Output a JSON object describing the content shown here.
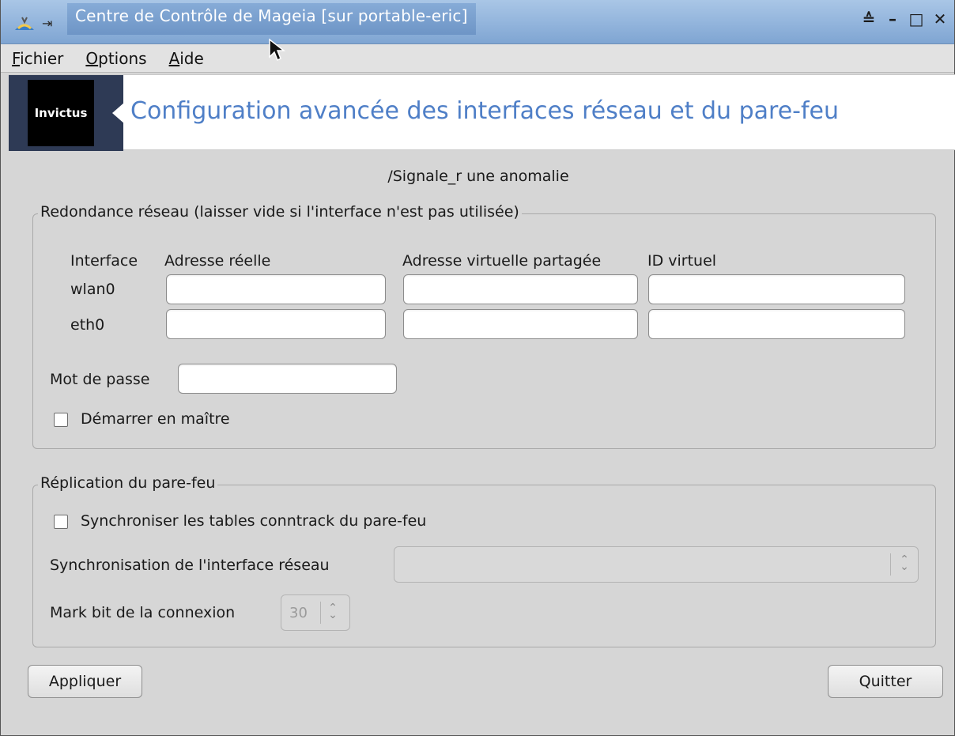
{
  "window": {
    "title": "Centre de Contrôle de Mageia  [sur portable-eric]",
    "pin_glyph": "⇥",
    "controls": [
      "≙",
      "–",
      "□",
      "✕"
    ]
  },
  "menubar": [
    {
      "first": "F",
      "rest": "ichier"
    },
    {
      "first": "O",
      "rest": "ptions"
    },
    {
      "first": "A",
      "rest": "ide"
    }
  ],
  "banner": {
    "logo_text": "Invictus",
    "title": "Configuration avancée des interfaces réseau et du pare-feu"
  },
  "bug_link": "/Signale_r une anomalie",
  "redundancy": {
    "legend": "Redondance réseau (laisser vide si l'interface n'est pas utilisée)",
    "headers": {
      "interface": "Interface",
      "real_address": "Adresse réelle",
      "virtual_address": "Adresse virtuelle partagée",
      "virtual_id": "ID virtuel"
    },
    "rows": [
      {
        "interface": "wlan0",
        "real_address": "",
        "virtual_address": "",
        "virtual_id": ""
      },
      {
        "interface": "eth0",
        "real_address": "",
        "virtual_address": "",
        "virtual_id": ""
      }
    ],
    "password_label": "Mot de passe",
    "password_value": "",
    "master_label": "Démarrer en maître",
    "master_checked": false
  },
  "replication": {
    "legend": "Réplication du pare-feu",
    "sync_label": "Synchroniser les tables conntrack du pare-feu",
    "sync_checked": false,
    "sync_interface_label": "Synchronisation de l'interface réseau",
    "sync_interface_value": "",
    "mark_label": "Mark bit de la connexion",
    "mark_value": "30"
  },
  "buttons": {
    "apply": "Appliquer",
    "quit": "Quitter"
  },
  "colors": {
    "titlebar": "#92b4dc",
    "banner_title": "#4f7fc7",
    "banner_logo_bg": "#2e3a55",
    "window_bg": "#d6d6d6"
  }
}
